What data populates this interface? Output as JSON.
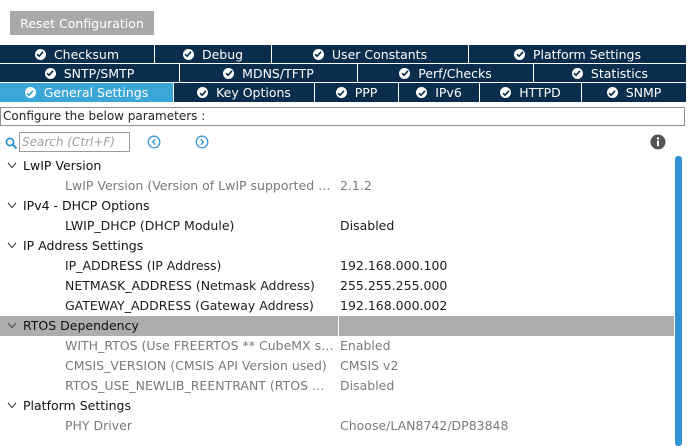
{
  "reset_button": "Reset Configuration",
  "tabs": {
    "row1": [
      {
        "label": "Checksum"
      },
      {
        "label": "Debug"
      },
      {
        "label": "User Constants"
      },
      {
        "label": "Platform Settings"
      }
    ],
    "row2": [
      {
        "label": "SNTP/SMTP"
      },
      {
        "label": "MDNS/TFTP"
      },
      {
        "label": "Perf/Checks"
      },
      {
        "label": "Statistics"
      }
    ],
    "row3": [
      {
        "label": "General Settings",
        "active": true
      },
      {
        "label": "Key Options"
      },
      {
        "label": "PPP"
      },
      {
        "label": "IPv6"
      },
      {
        "label": "HTTPD"
      },
      {
        "label": "SNMP"
      }
    ]
  },
  "banner": "Configure the below parameters :",
  "search": {
    "placeholder": "Search (Ctrl+F)"
  },
  "icons": {
    "search": "search-icon",
    "prev": "arrow-left-circle-icon",
    "next": "arrow-right-circle-icon",
    "info": "info-icon",
    "tab_check": "check-circle-icon",
    "expand": "chevron-down-icon"
  },
  "colors": {
    "tab_bg": "#0b2d4d",
    "tab_active": "#3aa7d8",
    "selected_row": "#adadad",
    "scrollbar": "#2f93d6",
    "button_bg": "#a9a9a9"
  },
  "tree": [
    {
      "group": "LwIP Version",
      "params": [
        {
          "name": "LwIP Version (Version of LwIP supported by …",
          "value": "2.1.2",
          "readonly": true
        }
      ]
    },
    {
      "group": "IPv4 - DHCP Options",
      "params": [
        {
          "name": "LWIP_DHCP (DHCP Module)",
          "value": "Disabled",
          "readonly": false
        }
      ]
    },
    {
      "group": "IP Address Settings",
      "params": [
        {
          "name": "IP_ADDRESS (IP Address)",
          "value": "192.168.000.100",
          "readonly": false
        },
        {
          "name": "NETMASK_ADDRESS (Netmask Address)",
          "value": "255.255.255.000",
          "readonly": false
        },
        {
          "name": "GATEWAY_ADDRESS (Gateway Address)",
          "value": "192.168.000.002",
          "readonly": false
        }
      ]
    },
    {
      "group": "RTOS Dependency",
      "selected": true,
      "params": [
        {
          "name": "WITH_RTOS (Use FREERTOS ** CubeMX s…",
          "value": "Enabled",
          "readonly": true
        },
        {
          "name": "CMSIS_VERSION (CMSIS API Version used)",
          "value": "CMSIS v2",
          "readonly": true
        },
        {
          "name": "RTOS_USE_NEWLIB_REENTRANT (RTOS …",
          "value": "Disabled",
          "readonly": true
        }
      ]
    },
    {
      "group": "Platform Settings",
      "params": [
        {
          "name": "PHY Driver",
          "value": "Choose/LAN8742/DP83848",
          "readonly": true
        }
      ]
    }
  ]
}
